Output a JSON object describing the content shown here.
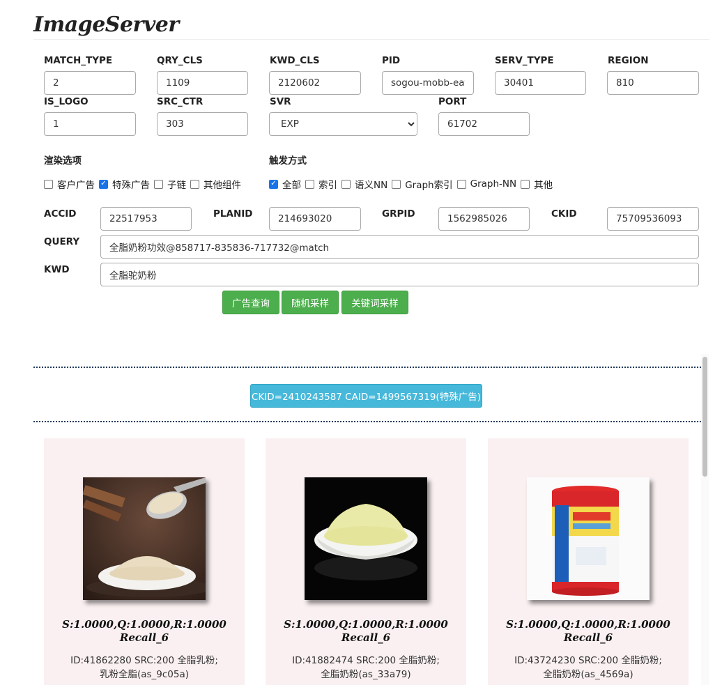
{
  "app": {
    "title": "ImageServer"
  },
  "fields": {
    "match_type": {
      "label": "MATCH_TYPE",
      "value": "2"
    },
    "qry_cls": {
      "label": "QRY_CLS",
      "value": "1109"
    },
    "kwd_cls": {
      "label": "KWD_CLS",
      "value": "2120602"
    },
    "pid": {
      "label": "PID",
      "value": "sogou-mobb-eafc"
    },
    "serv_type": {
      "label": "SERV_TYPE",
      "value": "30401"
    },
    "region": {
      "label": "REGION",
      "value": "810"
    },
    "is_logo": {
      "label": "IS_LOGO",
      "value": "1"
    },
    "src_ctr": {
      "label": "SRC_CTR",
      "value": "303"
    },
    "svr": {
      "label": "SVR",
      "value": "EXP",
      "options": [
        "EXP"
      ]
    },
    "port": {
      "label": "PORT",
      "value": "61702"
    }
  },
  "render_options": {
    "label": "渲染选项",
    "items": [
      {
        "label": "客户广告",
        "checked": false
      },
      {
        "label": "特殊广告",
        "checked": true
      },
      {
        "label": "子链",
        "checked": false
      },
      {
        "label": "其他组件",
        "checked": false
      }
    ]
  },
  "trigger": {
    "label": "触发方式",
    "items": [
      {
        "label": "全部",
        "checked": true
      },
      {
        "label": "索引",
        "checked": false
      },
      {
        "label": "语义NN",
        "checked": false
      },
      {
        "label": "Graph索引",
        "checked": false
      },
      {
        "label": "Graph-NN",
        "checked": false
      },
      {
        "label": "其他",
        "checked": false
      }
    ]
  },
  "ids": {
    "accid": {
      "label": "ACCID",
      "value": "22517953"
    },
    "planid": {
      "label": "PLANID",
      "value": "214693020"
    },
    "grpid": {
      "label": "GRPID",
      "value": "1562985026"
    },
    "ckid": {
      "label": "CKID",
      "value": "75709536093"
    }
  },
  "query": {
    "label": "QUERY",
    "value": "全脂奶粉功效@858717-835836-717732@match"
  },
  "kwd": {
    "label": "KWD",
    "value": "全脂驼奶粉"
  },
  "buttons": {
    "ad_query": "广告查询",
    "random_sample": "随机采样",
    "keyword_sample": "关键词采样"
  },
  "result_header": "CKID=2410243587 CAID=1499567319(特殊广告)",
  "colors": {
    "green": "#4cae4c",
    "info": "#46b8da",
    "card_bg": "#faf0f1",
    "checkbox": "#1a73e8"
  },
  "cards": [
    {
      "image": "milk-powder-spoon-bowl-image",
      "score": "S:1.0000,Q:1.0000,R:1.0000",
      "recall": "Recall_6",
      "desc": "ID:41862280 SRC:200 全脂乳粉;乳粉全脂(as_9c05a)"
    },
    {
      "image": "milk-powder-plate-image",
      "score": "S:1.0000,Q:1.0000,R:1.0000",
      "recall": "Recall_6",
      "desc": "ID:41882474 SRC:200 全脂奶粉;全脂奶粉(as_33a79)"
    },
    {
      "image": "nestle-milk-powder-can-image",
      "score": "S:1.0000,Q:1.0000,R:1.0000",
      "recall": "Recall_6",
      "desc": "ID:43724230 SRC:200 全脂奶粉;全脂奶粉(as_4569a)"
    }
  ]
}
